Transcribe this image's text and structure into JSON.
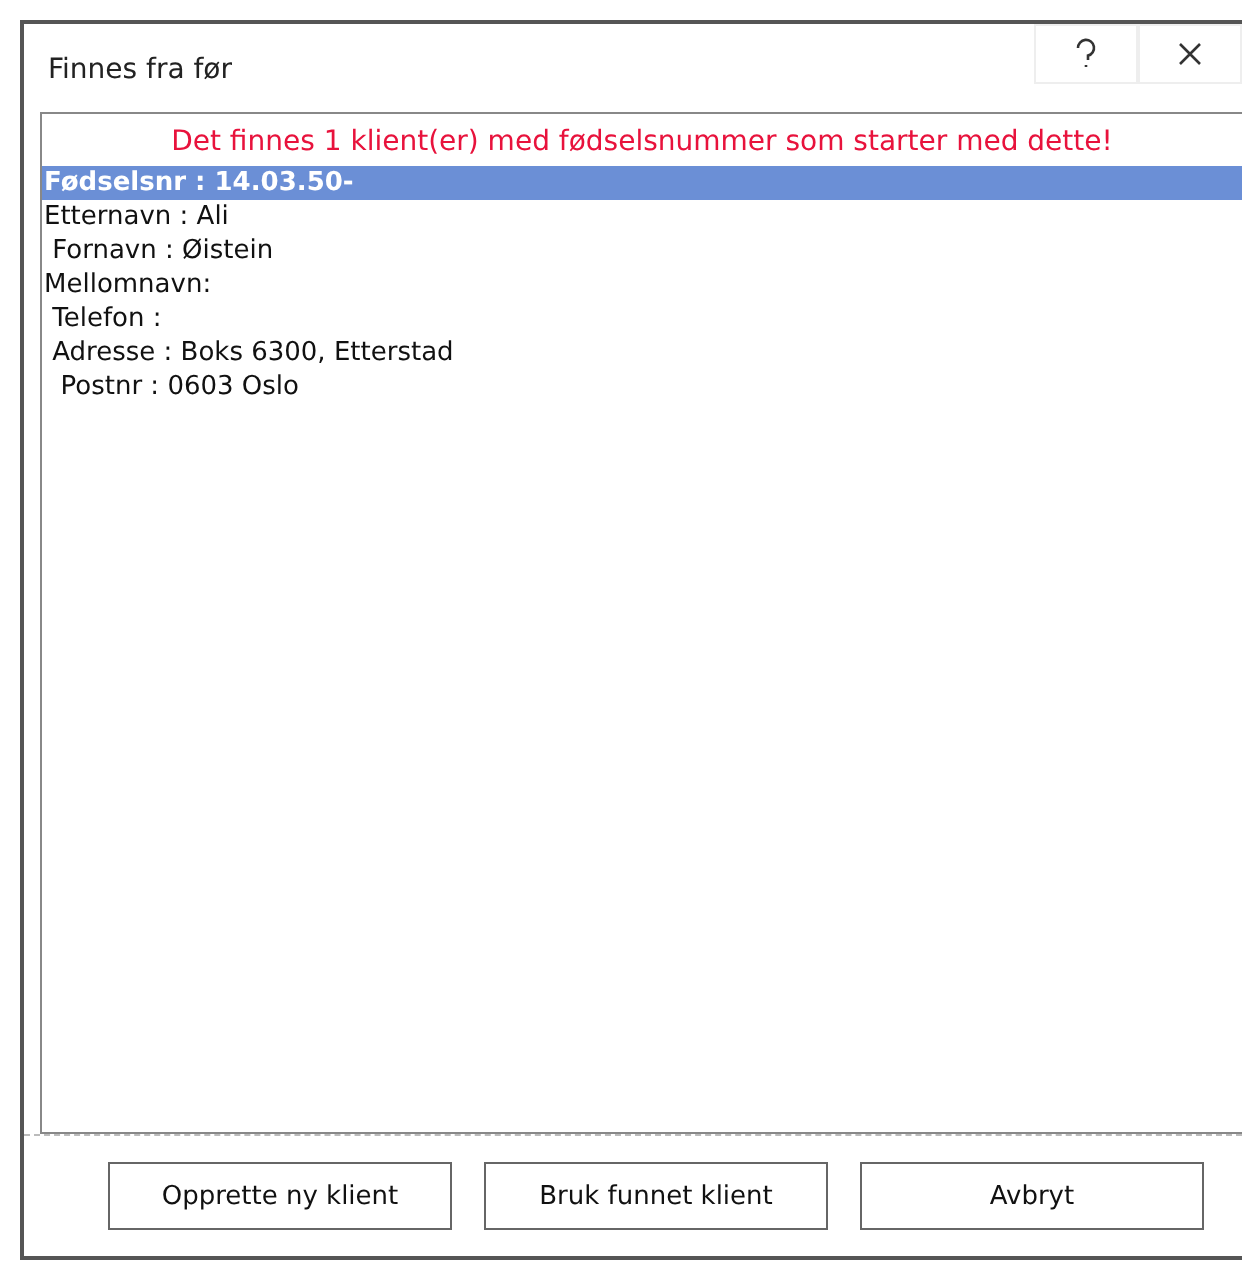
{
  "window": {
    "title": "Finnes fra før"
  },
  "message": "Det finnes 1 klient(er) med fødselsnummer som starter med dette!",
  "results": [
    {
      "text": "Fødselsnr : 14.03.50-",
      "selected": true
    },
    {
      "text": "Etternavn : Ali",
      "selected": false
    },
    {
      "text": " Fornavn : Øistein",
      "selected": false
    },
    {
      "text": "Mellomnavn:",
      "selected": false
    },
    {
      "text": " Telefon :",
      "selected": false
    },
    {
      "text": " Adresse : Boks 6300, Etterstad",
      "selected": false
    },
    {
      "text": "  Postnr : 0603 Oslo",
      "selected": false
    }
  ],
  "buttons": [
    "Opprette ny klient",
    "Bruk funnet klient",
    "Avbryt"
  ]
}
